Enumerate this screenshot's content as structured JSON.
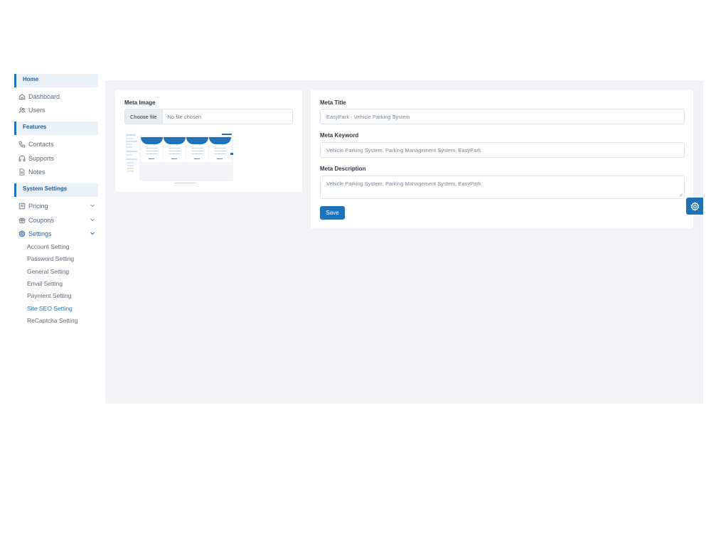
{
  "sidebar": {
    "sections": {
      "home": "Home",
      "features": "Features",
      "system_settings": "System Settings"
    },
    "items": {
      "dashboard": "Dashboard",
      "users": "Users",
      "contacts": "Contacts",
      "supports": "Supports",
      "notes": "Notes",
      "pricing": "Pricing",
      "coupons": "Coupons",
      "settings": "Settings"
    },
    "settings_sub": {
      "account": "Account Setting",
      "password": "Password Setting",
      "general": "General Setting",
      "email": "Email Setting",
      "payment": "Payment Setting",
      "seo": "Site SEO Setting",
      "recaptcha": "ReCaptcha Setting"
    },
    "active_sub": "Site SEO Setting"
  },
  "meta_image": {
    "label": "Meta Image",
    "choose_button": "Choose file",
    "file_status": "No file chosen"
  },
  "meta_form": {
    "title_label": "Meta Title",
    "title_value": "EasyPark - Vehicle Parking System",
    "keyword_label": "Meta Keyword",
    "keyword_value": "Vehicle Parking System, Parking Management System, EasyPark",
    "description_label": "Meta Description",
    "description_value": "Vehicle Parking System, Parking Management System, EasyPark",
    "save_label": "Save"
  },
  "colors": {
    "accent": "#1f72b8",
    "section_bg": "#e9f0f8",
    "main_bg": "#f1f3f7"
  },
  "icons": {
    "dashboard": "home-icon",
    "users": "users-icon",
    "contacts": "phone-icon",
    "supports": "headphones-icon",
    "notes": "file-icon",
    "pricing": "list-icon",
    "coupons": "gift-icon",
    "settings": "gear-icon",
    "floating": "gear-icon"
  }
}
